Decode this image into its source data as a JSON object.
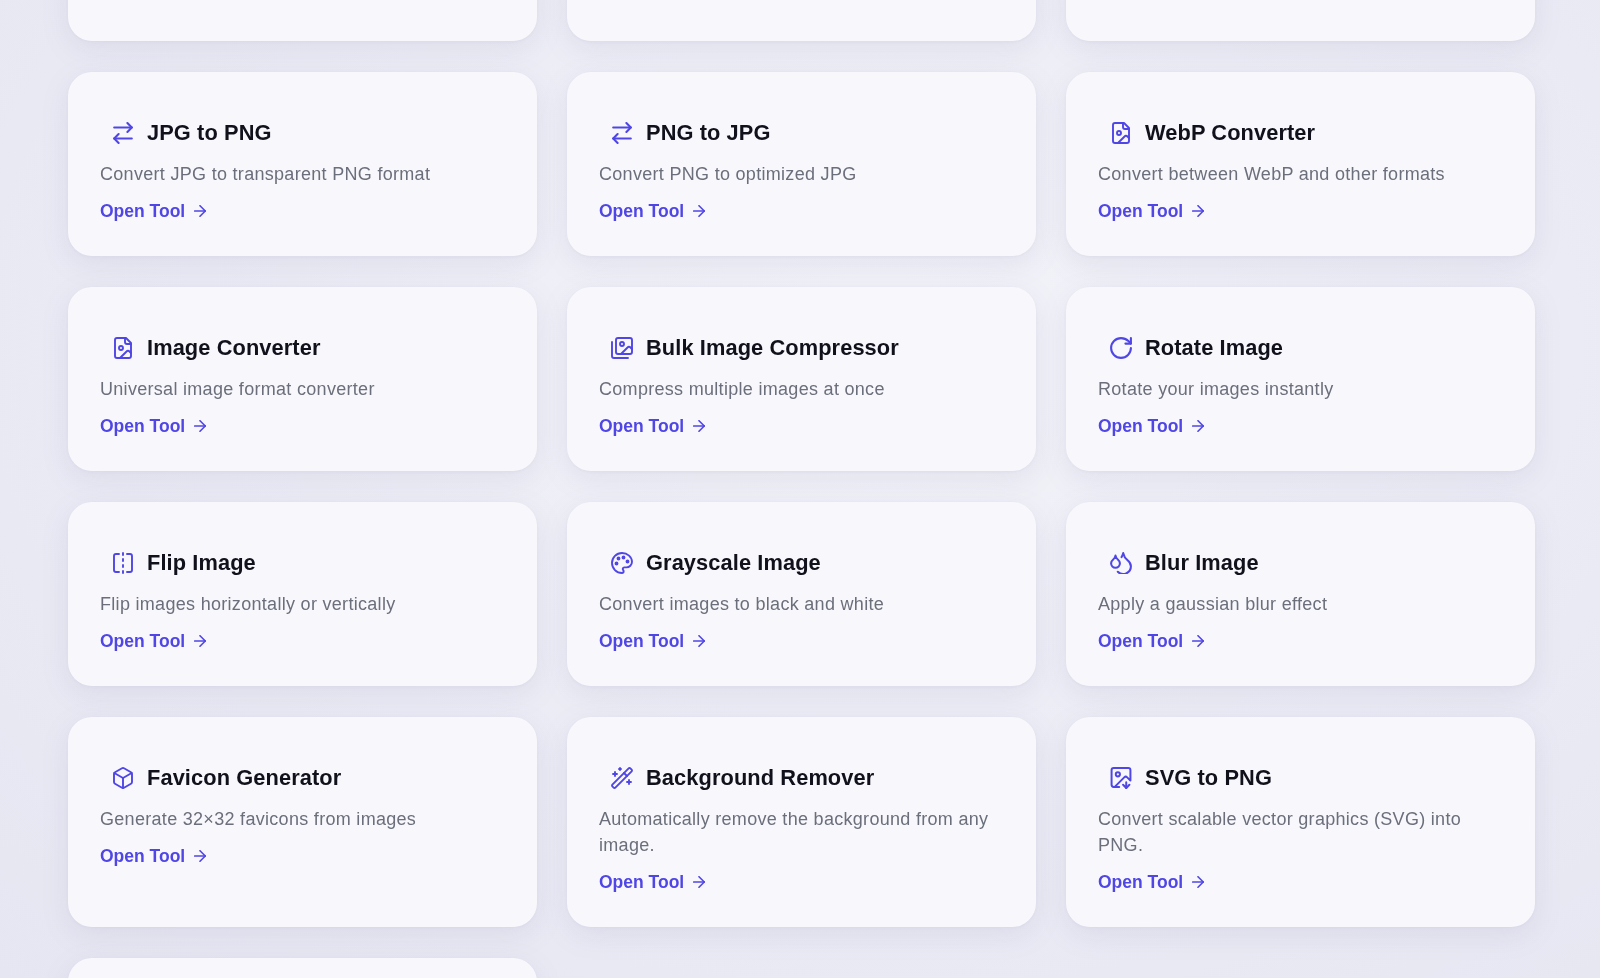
{
  "partial_row_above": true,
  "cards": [
    {
      "title": "JPG to PNG",
      "description": "Convert JPG to transparent PNG format",
      "link": "Open Tool"
    },
    {
      "title": "PNG to JPG",
      "description": "Convert PNG to optimized JPG",
      "link": "Open Tool"
    },
    {
      "title": "WebP Converter",
      "description": "Convert between WebP and other formats",
      "link": "Open Tool"
    },
    {
      "title": "Image Converter",
      "description": "Universal image format converter",
      "link": "Open Tool"
    },
    {
      "title": "Bulk Image Compressor",
      "description": "Compress multiple images at once",
      "link": "Open Tool"
    },
    {
      "title": "Rotate Image",
      "description": "Rotate your images instantly",
      "link": "Open Tool"
    },
    {
      "title": "Flip Image",
      "description": "Flip images horizontally or vertically",
      "link": "Open Tool"
    },
    {
      "title": "Grayscale Image",
      "description": "Convert images to black and white",
      "link": "Open Tool"
    },
    {
      "title": "Blur Image",
      "description": "Apply a gaussian blur effect",
      "link": "Open Tool"
    },
    {
      "title": "Favicon Generator",
      "description": "Generate 32×32 favicons from images",
      "link": "Open Tool"
    },
    {
      "title": "Background Remover",
      "description": "Automatically remove the background from any image.",
      "link": "Open Tool"
    },
    {
      "title": "SVG to PNG",
      "description": "Convert scalable vector graphics (SVG) into PNG.",
      "link": "Open Tool"
    }
  ],
  "partial_card_below": true
}
